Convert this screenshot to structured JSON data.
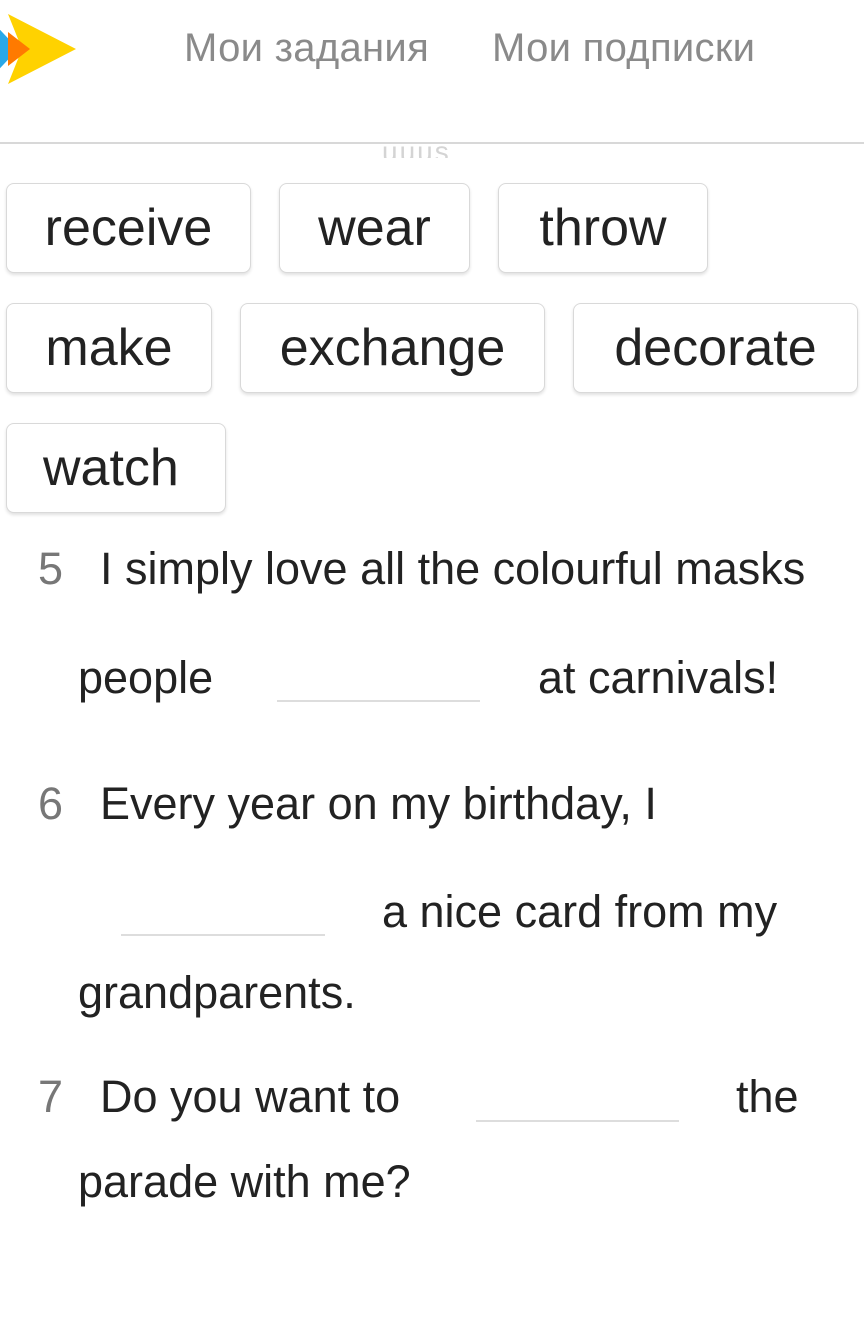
{
  "header": {
    "nav": {
      "my_tasks": "Мои задания",
      "my_subscriptions": "Мои подписки"
    },
    "ghost_text": "uuus"
  },
  "word_bank": [
    "receive",
    "wear",
    "throw",
    "make",
    "exchange",
    "decorate",
    "watch"
  ],
  "questions": {
    "q5": {
      "number": "5",
      "part1": "I simply love all the colourful masks",
      "part2": "people",
      "part3": "at carnivals!"
    },
    "q6": {
      "number": "6",
      "part1": "Every year on my birthday, I",
      "part2": "a nice card from my",
      "part3": "grandparents."
    },
    "q7": {
      "number": "7",
      "part1": "Do you want to",
      "part2": "the",
      "part3": "parade with me?"
    }
  },
  "colors": {
    "logo_blue": "#29a8e8",
    "logo_yellow": "#ffd200",
    "logo_orange": "#ff7a00"
  }
}
